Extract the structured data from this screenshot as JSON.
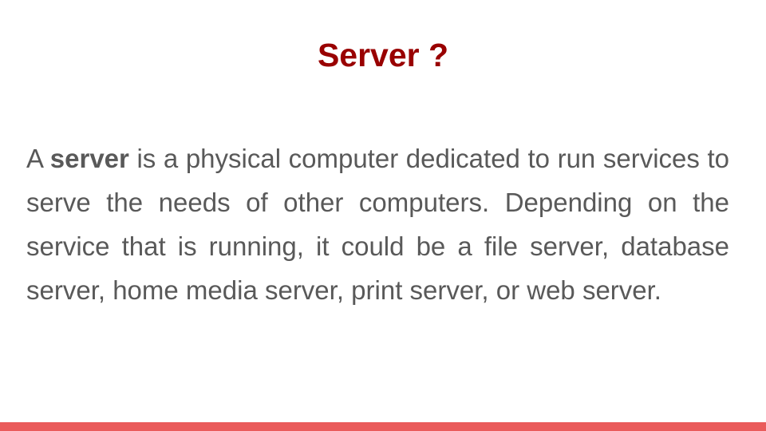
{
  "slide": {
    "title": "Server ?",
    "body": {
      "lead": "A ",
      "bold_term": "server",
      "rest": " is a physical computer dedicated to run services to serve the needs of other computers. Depending on the service that is running, it could be a file server, database server, home media server, print server, or web server."
    }
  },
  "colors": {
    "title": "#990000",
    "body_text": "#595959",
    "accent_bar": "#ea5b5b",
    "background": "#ffffff"
  }
}
